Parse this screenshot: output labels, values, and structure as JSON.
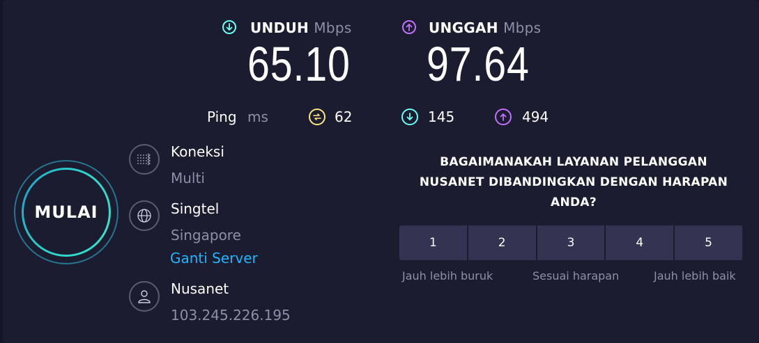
{
  "download": {
    "label": "UNDUH",
    "unit": "Mbps",
    "value": "65.10",
    "color": "#6afff3"
  },
  "upload": {
    "label": "UNGGAH",
    "unit": "Mbps",
    "value": "97.64",
    "color": "#bf71ff"
  },
  "ping": {
    "label": "Ping",
    "unit": "ms",
    "idle": "62",
    "download": "145",
    "upload": "494",
    "idle_color": "#fbe87f"
  },
  "start_button": {
    "label": "MULAI"
  },
  "connection": {
    "title": "Koneksi",
    "value": "Multi",
    "icon": "connections-icon"
  },
  "server": {
    "name": "Singtel",
    "location": "Singapore",
    "change_label": "Ganti Server",
    "icon": "globe-icon"
  },
  "provider": {
    "name": "Nusanet",
    "ip": "103.245.226.195",
    "icon": "user-icon"
  },
  "survey": {
    "question_lines": [
      "BAGAIMANAKAH LAYANAN PELANGGAN",
      "NUSANET DIBANDINGKAN DENGAN HARAPAN",
      "ANDA?"
    ],
    "options": [
      "1",
      "2",
      "3",
      "4",
      "5"
    ],
    "scale_low": "Jauh lebih buruk",
    "scale_mid": "Sesuai harapan",
    "scale_high": "Jauh lebih baik"
  }
}
